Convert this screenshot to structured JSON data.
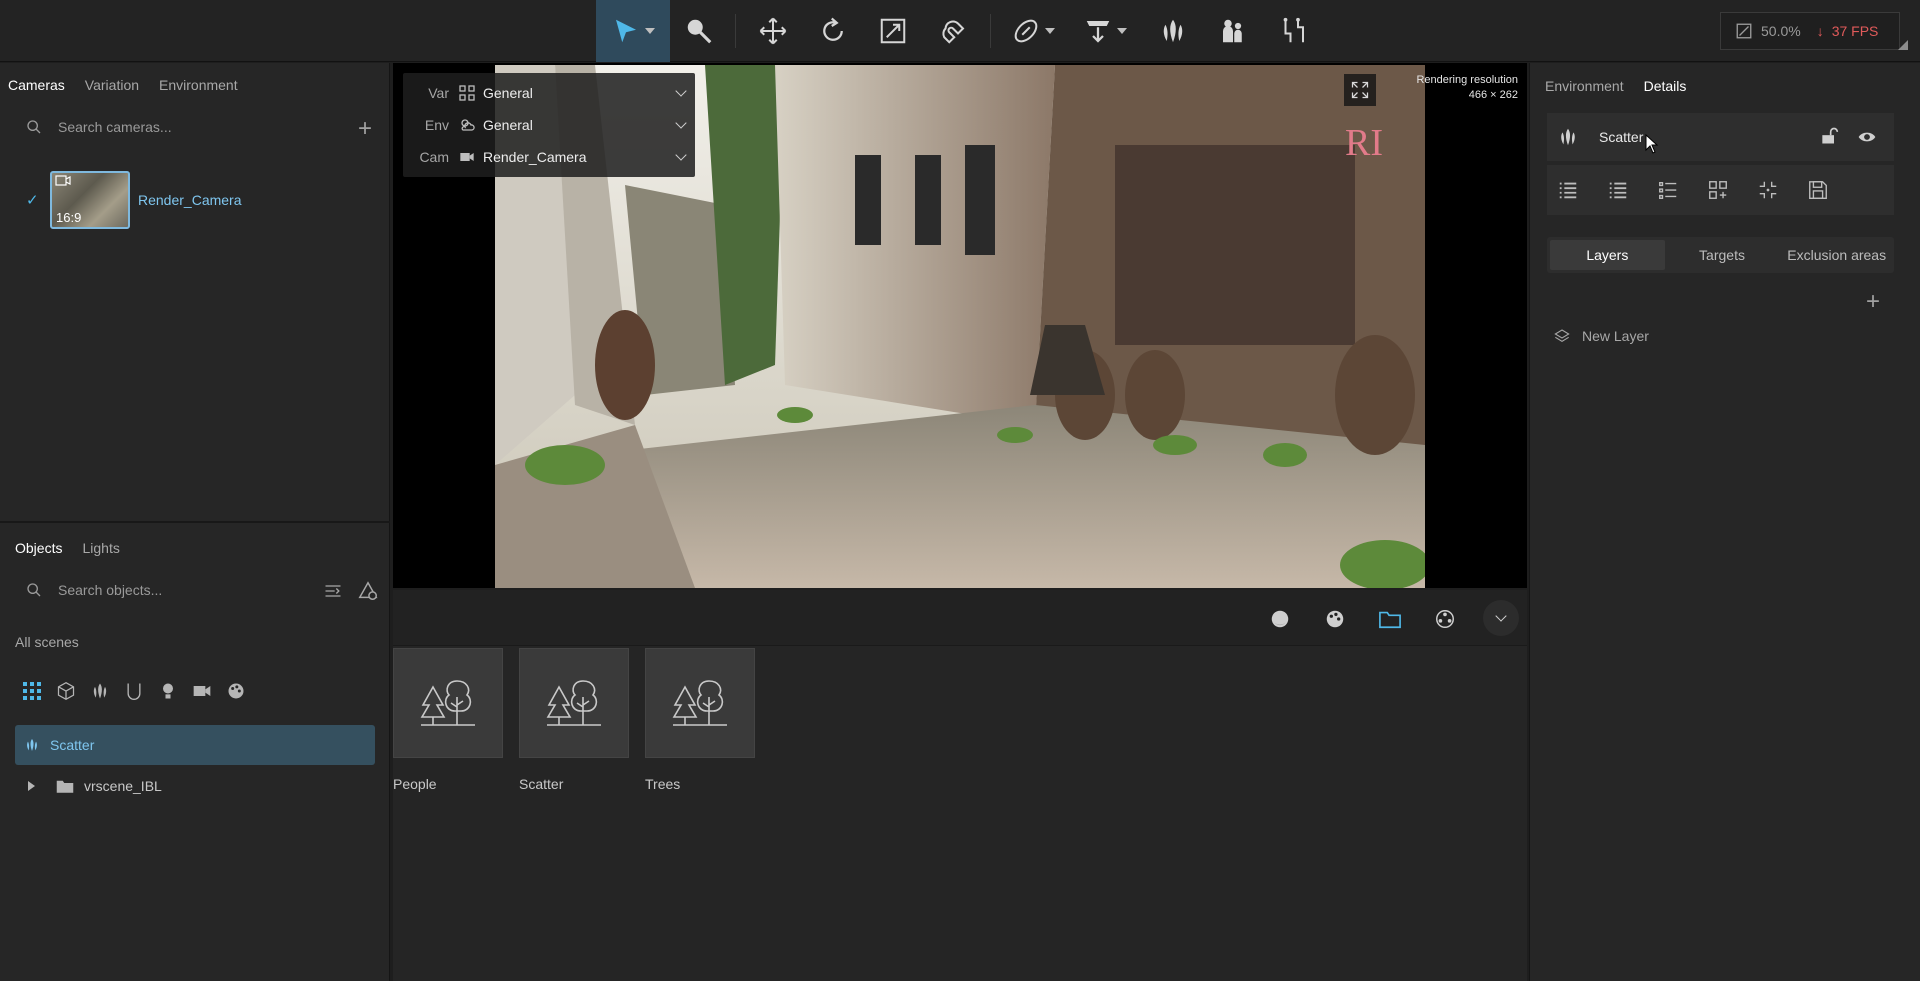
{
  "toolbar": {
    "tools": [
      {
        "icon": "select-arrow-icon",
        "active": true
      },
      {
        "icon": "paint-brush-icon"
      },
      {
        "icon": "move-icon"
      },
      {
        "icon": "rotate-icon"
      },
      {
        "icon": "scale-icon"
      },
      {
        "icon": "snap-magnet-icon"
      },
      {
        "icon": "paperclip-icon"
      },
      {
        "icon": "drop-to-floor-icon"
      },
      {
        "icon": "scatter-icon"
      },
      {
        "icon": "people-icon"
      },
      {
        "icon": "measure-icon"
      }
    ],
    "zoom": "50.0%",
    "fps": "37 FPS",
    "accent_color": "#4fb8e8",
    "fps_color": "#e05a5a"
  },
  "cameras_panel": {
    "tabs": [
      "Cameras",
      "Variation",
      "Environment"
    ],
    "search_placeholder": "Search cameras...",
    "camera": {
      "name": "Render_Camera",
      "aspect": "16:9"
    }
  },
  "objects_panel": {
    "tabs": [
      "Objects",
      "Lights"
    ],
    "search_placeholder": "Search objects...",
    "scope": "All scenes",
    "items": [
      {
        "label": "Scatter",
        "selected": true
      },
      {
        "label": "vrscene_IBL"
      }
    ]
  },
  "viewport": {
    "overlay": [
      {
        "key": "Var",
        "value": "General"
      },
      {
        "key": "Env",
        "value": "General"
      },
      {
        "key": "Cam",
        "value": "Render_Camera"
      }
    ],
    "resolution_label": "Rendering resolution",
    "resolution_value": "466 × 262"
  },
  "assets": {
    "items": [
      "People",
      "Scatter",
      "Trees"
    ]
  },
  "details_panel": {
    "tabs": [
      "Environment",
      "Details"
    ],
    "object_name": "Scatter",
    "subtabs": [
      "Layers",
      "Targets",
      "Exclusion areas"
    ],
    "layer_item": "New Layer"
  }
}
